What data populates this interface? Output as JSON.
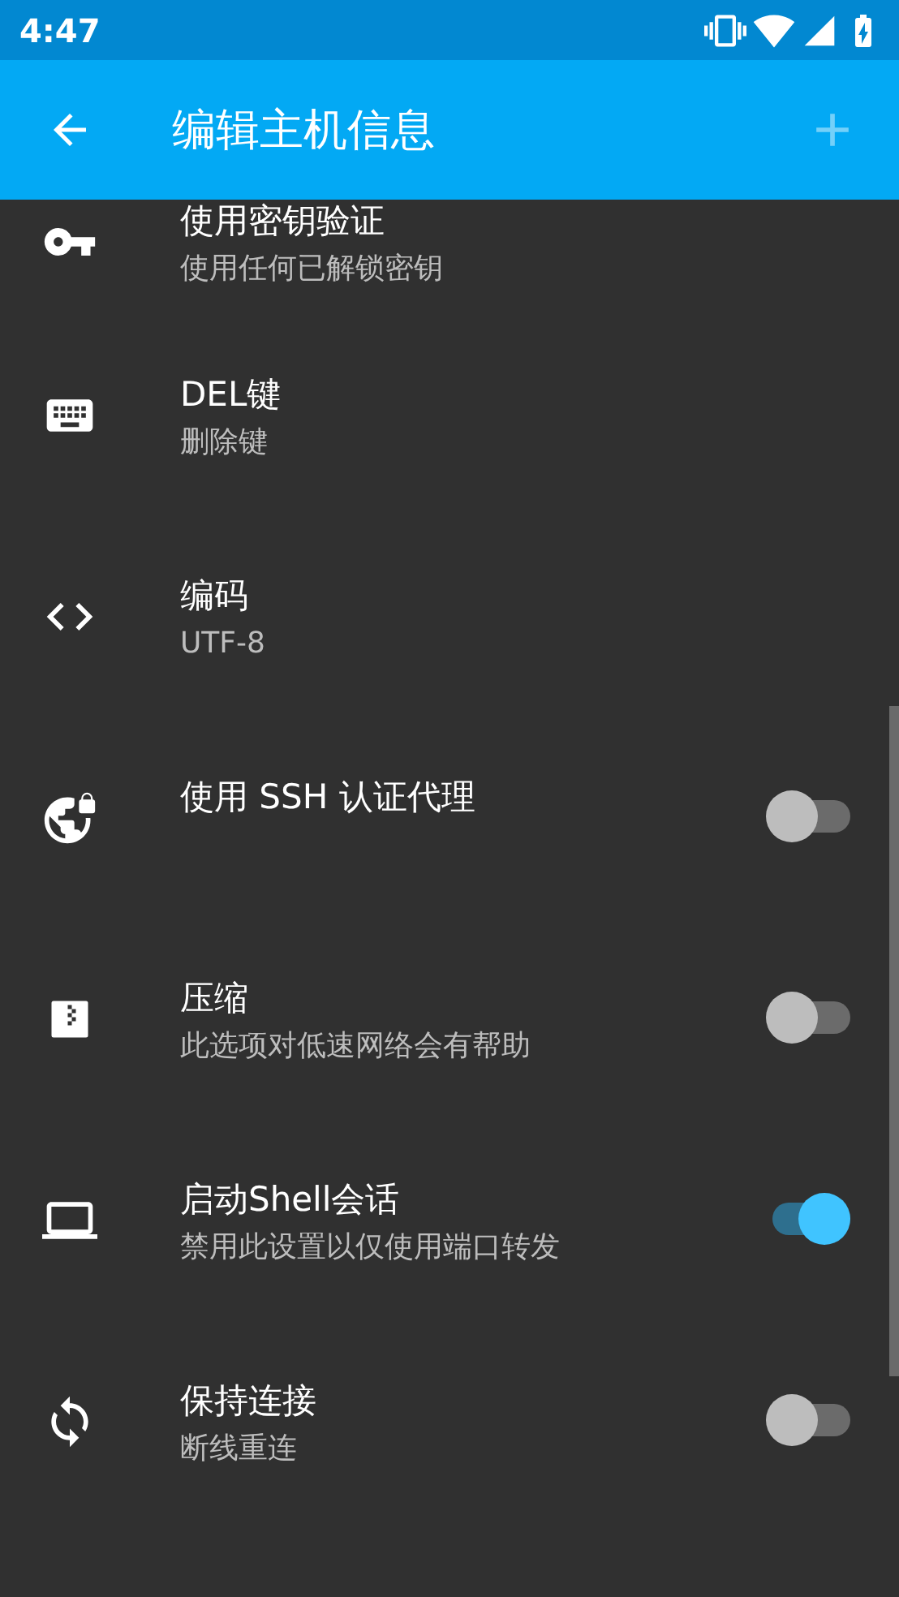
{
  "status_bar": {
    "time": "4:47"
  },
  "app_bar": {
    "title": "编辑主机信息",
    "add_disabled": true
  },
  "settings": [
    {
      "kind": "plain",
      "title": "使用密钥验证",
      "subtitle": "使用任何已解锁密钥"
    },
    {
      "kind": "plain",
      "title": "DEL键",
      "subtitle": "删除键"
    },
    {
      "kind": "plain",
      "title": "编码",
      "subtitle": "UTF-8"
    },
    {
      "kind": "toggle",
      "title": "使用 SSH 认证代理",
      "on": false
    },
    {
      "kind": "toggle",
      "title": "压缩",
      "subtitle": "此选项对低速网络会有帮助",
      "on": false
    },
    {
      "kind": "toggle",
      "title": "启动Shell会话",
      "subtitle": "禁用此设置以仅使用端口转发",
      "on": true
    },
    {
      "kind": "toggle",
      "title": "保持连接",
      "subtitle": "断线重连",
      "on": false
    }
  ]
}
